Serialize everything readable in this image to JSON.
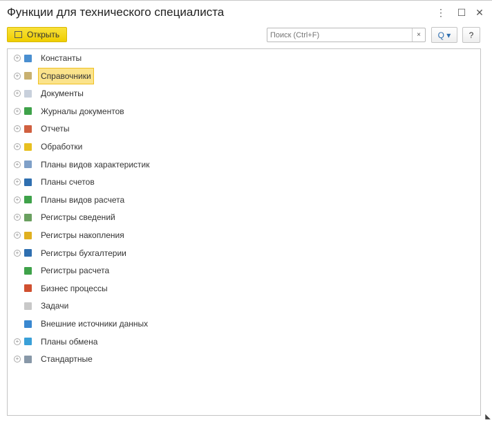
{
  "window": {
    "title": "Функции для технического специалиста",
    "menu_icon": "more-icon",
    "maximize_icon": "maximize-icon",
    "close_icon": "close-icon"
  },
  "toolbar": {
    "open_label": "Открыть",
    "search_placeholder": "Поиск (Ctrl+F)",
    "search_value": "",
    "clear_label": "×",
    "search_button": "Q ▾",
    "help_label": "?"
  },
  "tree": {
    "selected_index": 1,
    "items": [
      {
        "label": "Константы",
        "expandable": true,
        "color": "#4a8fd0"
      },
      {
        "label": "Справочники",
        "expandable": true,
        "color": "#c8b070"
      },
      {
        "label": "Документы",
        "expandable": true,
        "color": "#c8d0dc"
      },
      {
        "label": "Журналы документов",
        "expandable": true,
        "color": "#3fa24a"
      },
      {
        "label": "Отчеты",
        "expandable": true,
        "color": "#d06040"
      },
      {
        "label": "Обработки",
        "expandable": true,
        "color": "#e8c020"
      },
      {
        "label": "Планы видов характеристик",
        "expandable": true,
        "color": "#7fa0c8"
      },
      {
        "label": "Планы счетов",
        "expandable": true,
        "color": "#2f6fb0"
      },
      {
        "label": "Планы видов расчета",
        "expandable": true,
        "color": "#3fa24a"
      },
      {
        "label": "Регистры сведений",
        "expandable": true,
        "color": "#6aa060"
      },
      {
        "label": "Регистры накопления",
        "expandable": true,
        "color": "#e0b020"
      },
      {
        "label": "Регистры бухгалтерии",
        "expandable": true,
        "color": "#2f6fb0"
      },
      {
        "label": "Регистры расчета",
        "expandable": false,
        "color": "#3fa24a"
      },
      {
        "label": "Бизнес процессы",
        "expandable": false,
        "color": "#d05030"
      },
      {
        "label": "Задачи",
        "expandable": false,
        "color": "#c8c8c8"
      },
      {
        "label": "Внешние источники данных",
        "expandable": false,
        "color": "#3a88d0"
      },
      {
        "label": "Планы обмена",
        "expandable": true,
        "color": "#3aa0d8"
      },
      {
        "label": "Стандартные",
        "expandable": true,
        "color": "#8898a8"
      }
    ]
  }
}
